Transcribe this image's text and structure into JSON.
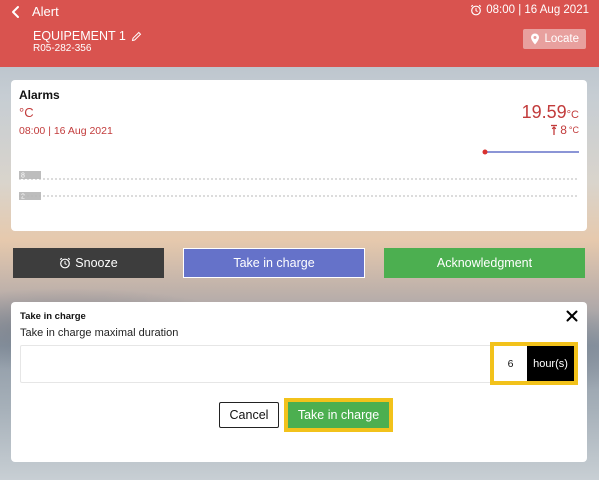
{
  "header": {
    "title": "Alert",
    "time": "08:00 | 16 Aug 2021",
    "equipment_name": "EQUIPEMENT 1",
    "equipment_code": "R05-282-356",
    "locate_label": "Locate"
  },
  "alarm_card": {
    "title": "Alarms",
    "unit": "°C",
    "date": "08:00 | 16 Aug 2021",
    "value": "19.59",
    "value_unit": "°C",
    "threshold": "8",
    "threshold_unit": "°C",
    "chart_labels": [
      "8",
      "2"
    ]
  },
  "actions": {
    "snooze": "Snooze",
    "take_in_charge": "Take in charge",
    "acknowledgment": "Acknowledgment"
  },
  "take_in_charge_panel": {
    "title": "Take in charge",
    "label": "Take in charge maximal duration",
    "duration_value": "6",
    "duration_unit": "hour(s)",
    "cancel": "Cancel",
    "confirm": "Take in charge"
  },
  "colors": {
    "header": "#d9534f",
    "alarm_red": "#c23b3b",
    "take_in_charge": "#6572c9",
    "acknowledgment": "#4caf50",
    "snooze": "#3d3d3d",
    "highlight": "#f2c21b"
  },
  "icons": {
    "back": "chevron-left-icon",
    "time": "alarm-clock-icon",
    "edit": "pencil-icon",
    "locate": "map-pin-icon",
    "threshold": "threshold-up-icon",
    "snooze": "alarm-clock-icon",
    "close": "close-icon"
  }
}
